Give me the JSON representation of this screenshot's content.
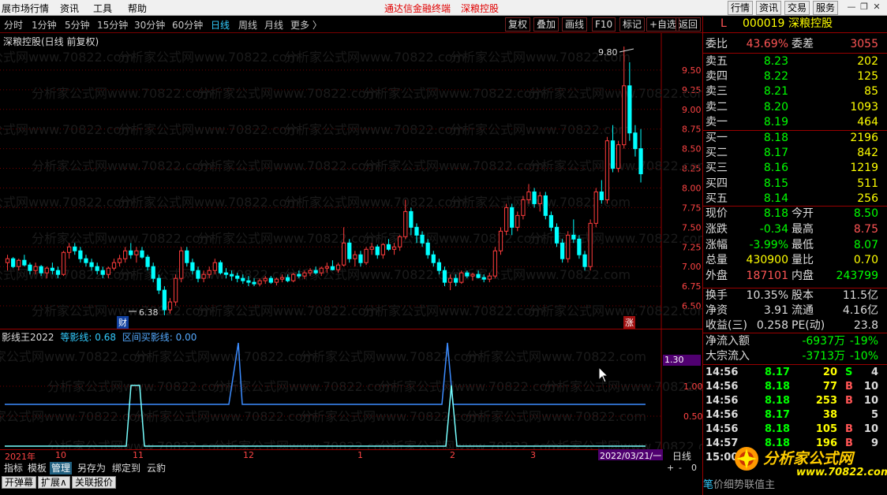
{
  "menubar": {
    "items": [
      "展市场行情",
      "资讯",
      "工具",
      "帮助"
    ],
    "center": [
      "通达信金融终端",
      "深粮控股"
    ],
    "right_buttons": [
      "行情",
      "资讯",
      "交易",
      "服务"
    ]
  },
  "period_tabs": [
    "分时",
    "1分钟",
    "5分钟",
    "15分钟",
    "30分钟",
    "60分钟",
    "日线",
    "周线",
    "月线",
    "更多 〉"
  ],
  "active_period": "日线",
  "toolbar": [
    "复权",
    "叠加",
    "画线",
    "F10",
    "标记",
    "+自选",
    "返回"
  ],
  "chart": {
    "title": "深粮控股(日线 前复权)",
    "high_label": "9.80",
    "low_label": "6.38",
    "cai_badge": "财",
    "zhang_badge": "涨",
    "watermark": "分析家公式网www.70822.com"
  },
  "indicator": {
    "name": "影线王2022",
    "l1_label": "等影线:",
    "l1_value": "0.68",
    "l2_label": "区间买影线:",
    "l2_value": "0.00",
    "marker": "1.30"
  },
  "xaxis": {
    "labels": [
      "2021年",
      "10",
      "11",
      "12",
      "1",
      "2",
      "3"
    ],
    "date": "2022/03/21/一",
    "period": "日线",
    "zoom": [
      "+",
      "-",
      "0"
    ]
  },
  "bottom_tabs": [
    "指标",
    "模板",
    "管理",
    "另存为",
    "绑定到",
    "云豹"
  ],
  "bottom_tabs_active": "管理",
  "bottom_buttons": [
    "开弹幕",
    "扩展∧",
    "关联报价"
  ],
  "quote": {
    "letter": "L",
    "code": "000019",
    "name": "深粮控股",
    "weibi_label": "委比",
    "weibi": "43.69%",
    "weicha_label": "委差",
    "weicha": "3055",
    "asks": [
      {
        "label": "卖五",
        "price": "8.23",
        "vol": "202"
      },
      {
        "label": "卖四",
        "price": "8.22",
        "vol": "125"
      },
      {
        "label": "卖三",
        "price": "8.21",
        "vol": "85"
      },
      {
        "label": "卖二",
        "price": "8.20",
        "vol": "1093"
      },
      {
        "label": "卖一",
        "price": "8.19",
        "vol": "464"
      }
    ],
    "bids": [
      {
        "label": "买一",
        "price": "8.18",
        "vol": "2196"
      },
      {
        "label": "买二",
        "price": "8.17",
        "vol": "842"
      },
      {
        "label": "买三",
        "price": "8.16",
        "vol": "1219"
      },
      {
        "label": "买四",
        "price": "8.15",
        "vol": "511"
      },
      {
        "label": "买五",
        "price": "8.14",
        "vol": "256"
      }
    ],
    "stats": [
      {
        "l1": "现价",
        "v1": "8.18",
        "c1": "g",
        "l2": "今开",
        "v2": "8.50",
        "c2": "g"
      },
      {
        "l1": "涨跌",
        "v1": "-0.34",
        "c1": "g",
        "l2": "最高",
        "v2": "8.75",
        "c2": "r"
      },
      {
        "l1": "涨幅",
        "v1": "-3.99%",
        "c1": "g",
        "l2": "最低",
        "v2": "8.07",
        "c2": "g"
      },
      {
        "l1": "总量",
        "v1": "430900",
        "c1": "y",
        "l2": "量比",
        "v2": "0.70",
        "c2": "y"
      },
      {
        "l1": "外盘",
        "v1": "187101",
        "c1": "r",
        "l2": "内盘",
        "v2": "243799",
        "c2": "g"
      }
    ],
    "stats2": [
      {
        "l1": "换手",
        "v1": "10.35%",
        "l2": "股本",
        "v2": "11.5亿"
      },
      {
        "l1": "净资",
        "v1": "3.91",
        "l2": "流通",
        "v2": "4.16亿"
      },
      {
        "l1": "收益(三)",
        "v1": "0.258",
        "l2": "PE(动)",
        "v2": "23.8"
      }
    ],
    "flows": [
      {
        "label": "净流入额",
        "amount": "-6937万",
        "pct": "-19%"
      },
      {
        "label": "大宗流入",
        "amount": "-3713万",
        "pct": "-10%"
      }
    ],
    "ticks": [
      {
        "time": "14:56",
        "price": "8.17",
        "vol": "20",
        "side": "S",
        "n": "4"
      },
      {
        "time": "14:56",
        "price": "8.18",
        "vol": "77",
        "side": "B",
        "n": "10"
      },
      {
        "time": "14:56",
        "price": "8.18",
        "vol": "253",
        "side": "B",
        "n": "10"
      },
      {
        "time": "14:56",
        "price": "8.17",
        "vol": "38",
        "side": "",
        "n": "5"
      },
      {
        "time": "14:56",
        "price": "8.18",
        "vol": "105",
        "side": "B",
        "n": "10"
      },
      {
        "time": "14:57",
        "price": "8.18",
        "vol": "196",
        "side": "B",
        "n": "9"
      },
      {
        "time": "15:00",
        "price": "",
        "vol": "",
        "side": "",
        "n": ""
      }
    ],
    "bottom_tabs": [
      "笔",
      "价",
      "细",
      "势",
      "联",
      "值",
      "主"
    ],
    "logo_text": "分析家公式网",
    "logo_url": "www.70822.com"
  },
  "chart_data": {
    "type": "candlestick",
    "ylabels": [
      "9.50",
      "9.25",
      "9.00",
      "8.75",
      "8.50",
      "8.25",
      "8.00",
      "7.75",
      "7.50",
      "7.25",
      "7.00",
      "6.75",
      "6.50"
    ],
    "ohlc": [
      [
        7.05,
        7.15,
        6.95,
        7.1
      ],
      [
        7.1,
        7.12,
        6.98,
        7.0
      ],
      [
        7.0,
        7.1,
        6.95,
        7.08
      ],
      [
        7.08,
        7.15,
        7.0,
        7.02
      ],
      [
        7.02,
        7.05,
        6.9,
        6.95
      ],
      [
        6.95,
        7.05,
        6.9,
        7.0
      ],
      [
        7.0,
        7.02,
        6.88,
        6.92
      ],
      [
        6.92,
        7.0,
        6.85,
        6.98
      ],
      [
        6.98,
        7.05,
        6.9,
        6.95
      ],
      [
        6.95,
        7.0,
        6.85,
        6.9
      ],
      [
        6.9,
        7.2,
        6.88,
        7.18
      ],
      [
        7.18,
        7.3,
        7.1,
        7.25
      ],
      [
        7.25,
        7.3,
        7.15,
        7.2
      ],
      [
        7.2,
        7.25,
        7.05,
        7.1
      ],
      [
        7.1,
        7.15,
        7.0,
        7.05
      ],
      [
        7.05,
        7.1,
        6.95,
        7.0
      ],
      [
        7.0,
        7.05,
        6.9,
        6.95
      ],
      [
        6.95,
        7.0,
        6.85,
        6.9
      ],
      [
        6.9,
        7.0,
        6.85,
        6.98
      ],
      [
        6.98,
        7.1,
        6.95,
        7.05
      ],
      [
        7.05,
        7.15,
        7.0,
        7.1
      ],
      [
        7.1,
        7.25,
        7.05,
        7.2
      ],
      [
        7.2,
        7.3,
        7.1,
        7.15
      ],
      [
        7.15,
        7.25,
        7.05,
        7.2
      ],
      [
        7.2,
        7.25,
        7.1,
        7.12
      ],
      [
        7.12,
        7.15,
        6.95,
        7.0
      ],
      [
        7.0,
        7.05,
        6.8,
        6.85
      ],
      [
        6.85,
        6.9,
        6.65,
        6.7
      ],
      [
        6.7,
        6.75,
        6.38,
        6.45
      ],
      [
        6.45,
        6.6,
        6.4,
        6.55
      ],
      [
        6.55,
        6.9,
        6.5,
        6.85
      ],
      [
        6.85,
        7.25,
        6.8,
        7.2
      ],
      [
        7.2,
        7.25,
        7.0,
        7.05
      ],
      [
        7.05,
        7.1,
        6.9,
        6.95
      ],
      [
        6.95,
        7.0,
        6.8,
        6.85
      ],
      [
        6.85,
        6.95,
        6.8,
        6.9
      ],
      [
        6.9,
        7.0,
        6.85,
        6.95
      ],
      [
        6.95,
        7.1,
        6.9,
        7.05
      ],
      [
        7.05,
        7.08,
        6.9,
        6.92
      ],
      [
        6.92,
        6.98,
        6.85,
        6.9
      ],
      [
        6.9,
        6.95,
        6.82,
        6.88
      ],
      [
        6.88,
        6.92,
        6.8,
        6.85
      ],
      [
        6.85,
        6.9,
        6.78,
        6.82
      ],
      [
        6.82,
        6.88,
        6.75,
        6.8
      ],
      [
        6.8,
        6.85,
        6.75,
        6.78
      ],
      [
        6.78,
        6.85,
        6.75,
        6.82
      ],
      [
        6.82,
        6.88,
        6.78,
        6.85
      ],
      [
        6.85,
        6.88,
        6.78,
        6.8
      ],
      [
        6.8,
        6.86,
        6.76,
        6.84
      ],
      [
        6.84,
        6.9,
        6.8,
        6.86
      ],
      [
        6.86,
        6.9,
        6.8,
        6.82
      ],
      [
        6.82,
        6.92,
        6.8,
        6.9
      ],
      [
        6.9,
        6.95,
        6.85,
        6.88
      ],
      [
        6.88,
        6.95,
        6.84,
        6.92
      ],
      [
        6.92,
        6.98,
        6.88,
        6.95
      ],
      [
        6.95,
        7.0,
        6.9,
        6.92
      ],
      [
        6.92,
        7.0,
        6.88,
        6.98
      ],
      [
        6.98,
        7.05,
        6.92,
        7.0
      ],
      [
        7.0,
        7.08,
        6.95,
        6.96
      ],
      [
        6.96,
        7.05,
        6.92,
        7.02
      ],
      [
        7.02,
        7.5,
        7.0,
        7.3
      ],
      [
        7.3,
        7.35,
        7.05,
        7.1
      ],
      [
        7.1,
        7.2,
        7.0,
        7.15
      ],
      [
        7.15,
        7.2,
        7.0,
        7.05
      ],
      [
        7.05,
        7.25,
        7.02,
        7.22
      ],
      [
        7.22,
        7.3,
        7.15,
        7.25
      ],
      [
        7.25,
        7.28,
        7.1,
        7.15
      ],
      [
        7.15,
        7.3,
        7.1,
        7.28
      ],
      [
        7.28,
        7.35,
        7.2,
        7.22
      ],
      [
        7.22,
        7.3,
        7.15,
        7.25
      ],
      [
        7.25,
        7.4,
        7.2,
        7.38
      ],
      [
        7.38,
        7.85,
        7.35,
        7.7
      ],
      [
        7.7,
        7.75,
        7.4,
        7.5
      ],
      [
        7.5,
        7.55,
        7.3,
        7.4
      ],
      [
        7.4,
        7.45,
        7.25,
        7.3
      ],
      [
        7.3,
        7.35,
        7.1,
        7.15
      ],
      [
        7.15,
        7.2,
        7.0,
        7.05
      ],
      [
        7.05,
        7.1,
        6.9,
        6.95
      ],
      [
        6.95,
        7.0,
        6.75,
        6.8
      ],
      [
        6.8,
        6.9,
        6.7,
        6.85
      ],
      [
        6.85,
        6.9,
        6.75,
        6.8
      ],
      [
        6.8,
        6.95,
        6.78,
        6.92
      ],
      [
        6.92,
        6.95,
        6.85,
        6.88
      ],
      [
        6.88,
        6.92,
        6.82,
        6.9
      ],
      [
        6.9,
        6.95,
        6.85,
        6.86
      ],
      [
        6.86,
        6.9,
        6.8,
        6.84
      ],
      [
        6.84,
        6.92,
        6.8,
        6.88
      ],
      [
        6.88,
        7.25,
        6.85,
        7.2
      ],
      [
        7.2,
        7.5,
        7.15,
        7.45
      ],
      [
        7.45,
        7.8,
        7.4,
        7.75
      ],
      [
        7.75,
        7.8,
        7.4,
        7.5
      ],
      [
        7.5,
        7.7,
        7.45,
        7.65
      ],
      [
        7.65,
        7.9,
        7.6,
        7.85
      ],
      [
        7.85,
        8.05,
        7.8,
        7.95
      ],
      [
        7.95,
        8.0,
        7.75,
        7.8
      ],
      [
        7.8,
        7.95,
        7.7,
        7.9
      ],
      [
        7.9,
        7.95,
        7.6,
        7.65
      ],
      [
        7.65,
        7.7,
        7.45,
        7.5
      ],
      [
        7.5,
        7.55,
        7.25,
        7.3
      ],
      [
        7.3,
        7.35,
        7.05,
        7.1
      ],
      [
        7.1,
        7.45,
        7.05,
        7.4
      ],
      [
        7.4,
        7.6,
        7.3,
        7.35
      ],
      [
        7.35,
        7.4,
        7.1,
        7.15
      ],
      [
        7.15,
        7.2,
        6.95,
        7.0
      ],
      [
        7.0,
        7.6,
        6.95,
        7.55
      ],
      [
        7.55,
        8.0,
        7.5,
        7.95
      ],
      [
        7.95,
        8.1,
        7.8,
        7.85
      ],
      [
        7.85,
        8.65,
        7.8,
        8.6
      ],
      [
        8.6,
        8.8,
        8.2,
        8.25
      ],
      [
        8.25,
        8.6,
        8.2,
        8.55
      ],
      [
        8.55,
        9.8,
        8.5,
        9.3
      ],
      [
        9.3,
        9.6,
        8.6,
        8.7
      ],
      [
        8.7,
        8.8,
        8.4,
        8.5
      ],
      [
        8.5,
        8.75,
        8.07,
        8.18
      ]
    ]
  },
  "indicator_data": {
    "type": "line",
    "series": [
      {
        "name": "等影线",
        "values": [
          0.68
        ]
      },
      {
        "name": "区间买影线",
        "values": [
          0.0
        ]
      }
    ]
  }
}
